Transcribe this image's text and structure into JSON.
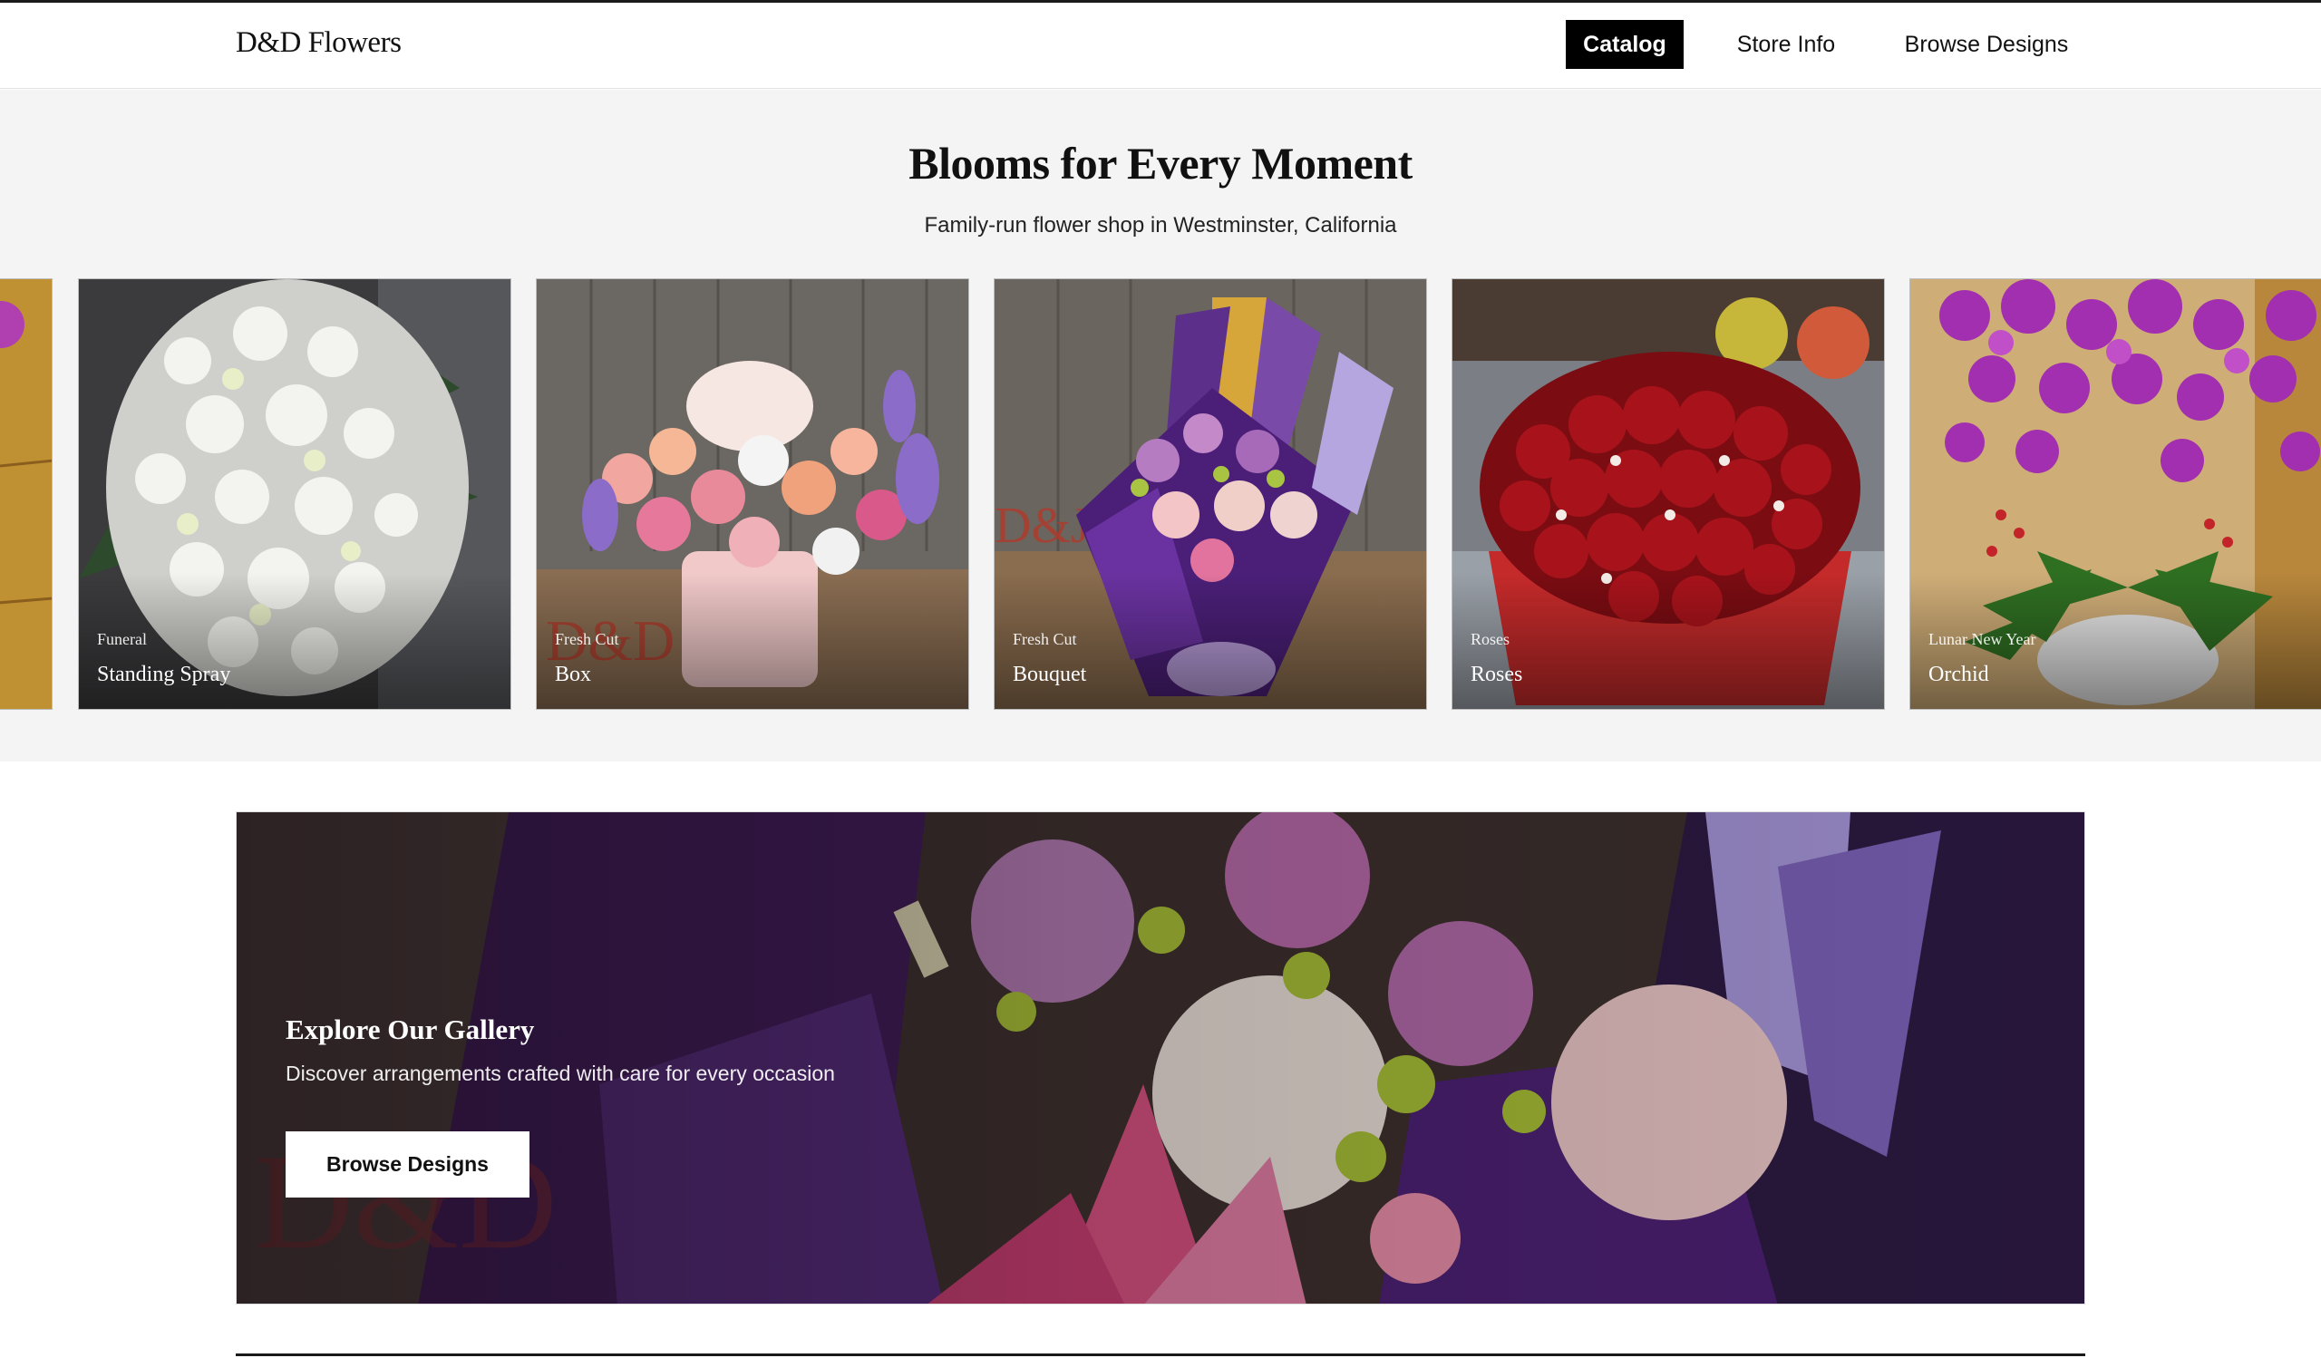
{
  "header": {
    "brand": "D&D Flowers",
    "nav": [
      "Catalog",
      "Store Info",
      "Browse Designs"
    ],
    "active": "Catalog"
  },
  "hero": {
    "title": "Blooms for Every Moment",
    "subtitle": "Family-run flower shop in Westminster, California"
  },
  "carousel": {
    "cards": [
      {
        "category": "Funeral",
        "name": "Standing Spray"
      },
      {
        "category": "Fresh Cut",
        "name": "Box"
      },
      {
        "category": "Fresh Cut",
        "name": "Bouquet"
      },
      {
        "category": "Roses",
        "name": "Roses"
      },
      {
        "category": "Lunar New Year",
        "name": "Orchid"
      }
    ]
  },
  "gallery": {
    "title": "Explore Our Gallery",
    "subtitle": "Discover arrangements crafted with care for every occasion",
    "button": "Browse Designs"
  }
}
